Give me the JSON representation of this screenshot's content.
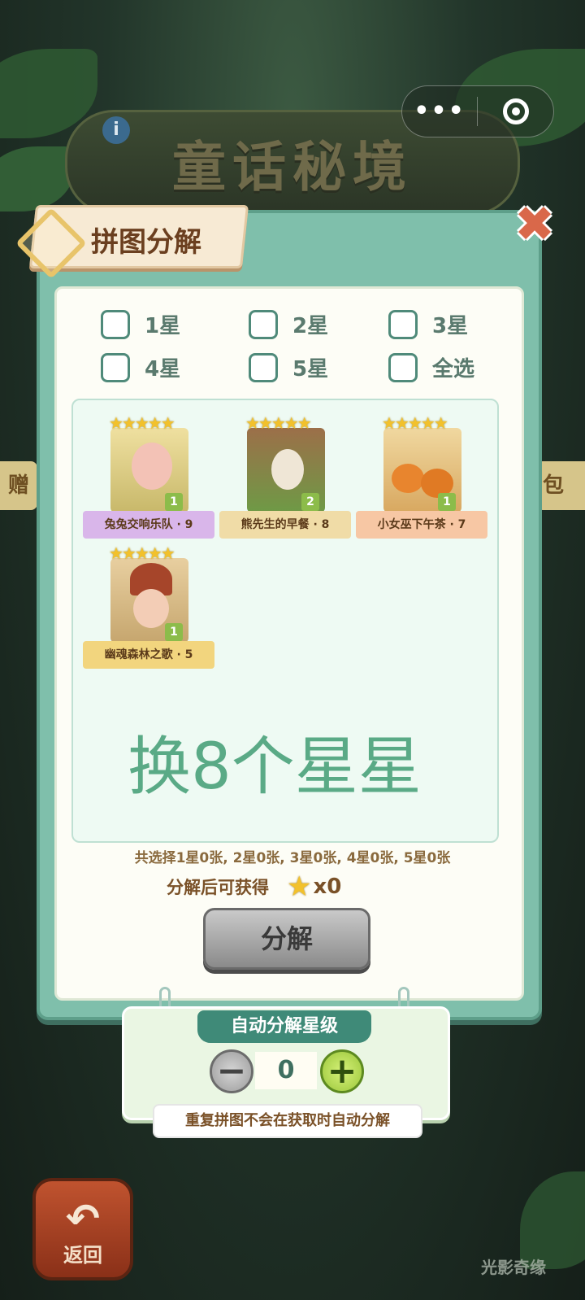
{
  "colors": {
    "modal_bg": "#7fbfab",
    "accent_green": "#5aaa86",
    "title_brown": "#6b3f1f",
    "button_gray": "#9b9b9b",
    "plus_green": "#9ac63a"
  },
  "header": {
    "game_title": "童话秘境",
    "info_icon": "i",
    "capsule_menu": "•••"
  },
  "modal": {
    "title": "拼图分解",
    "close_icon": "✖",
    "filters": [
      {
        "label": "1星",
        "checked": false
      },
      {
        "label": "2星",
        "checked": false
      },
      {
        "label": "3星",
        "checked": false
      },
      {
        "label": "4星",
        "checked": false
      },
      {
        "label": "5星",
        "checked": false
      },
      {
        "label": "全选",
        "checked": false
      }
    ],
    "cards": [
      {
        "name": "兔兔交响乐队 · 9",
        "stars": "★★★★★",
        "count": "1"
      },
      {
        "name": "熊先生的早餐 · 8",
        "stars": "★★★★★",
        "count": "2"
      },
      {
        "name": "小女巫下午茶 · 7",
        "stars": "★★★★★",
        "count": "1"
      },
      {
        "name": "幽魂森林之歌 · 5",
        "stars": "★★★★★",
        "count": "1"
      }
    ],
    "exchange_text": "换8个星星",
    "summary": "共选择1星0张, 2星0张, 3星0张, 4星0张, 5星0张",
    "gain_label": "分解后可获得",
    "gain_value": "x0",
    "decompose_button": "分解"
  },
  "auto_panel": {
    "title": "自动分解星级",
    "minus": "−",
    "plus": "+",
    "level": "0",
    "note": "重复拼图不会在获取时自动分解"
  },
  "background": {
    "left_tag": "赠",
    "right_tag": "包",
    "back_button": "返回",
    "watermark": "光影奇缘"
  }
}
